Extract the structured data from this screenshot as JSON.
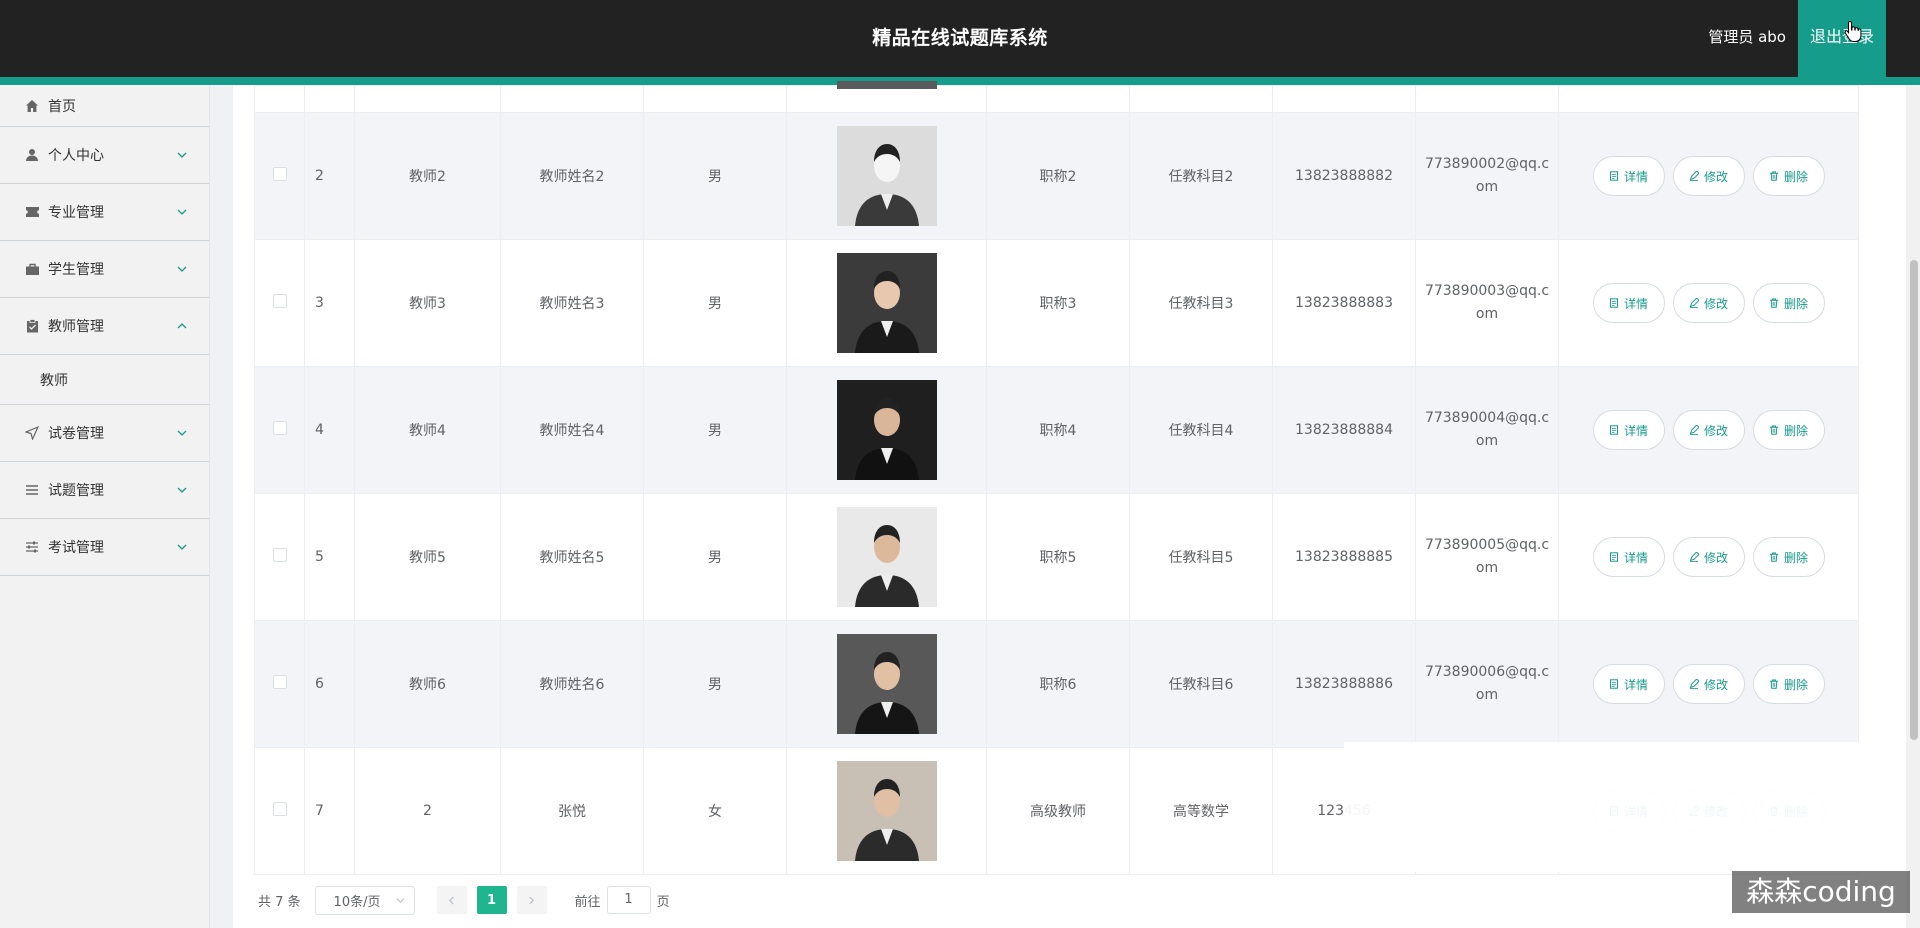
{
  "header": {
    "title": "精品在线试题库系统",
    "user": "管理员 abo",
    "logout_label": "退出登录"
  },
  "sidebar": {
    "items": [
      {
        "label": "首页",
        "icon": "home-icon"
      },
      {
        "label": "个人中心",
        "icon": "user-icon"
      },
      {
        "label": "专业管理",
        "icon": "ticket-icon"
      },
      {
        "label": "学生管理",
        "icon": "briefcase-icon"
      },
      {
        "label": "教师管理",
        "icon": "clipboard-icon",
        "expanded": true,
        "children": [
          "教师"
        ]
      },
      {
        "label": "试卷管理",
        "icon": "send-icon"
      },
      {
        "label": "试题管理",
        "icon": "list-icon"
      },
      {
        "label": "考试管理",
        "icon": "sliders-icon"
      }
    ]
  },
  "table": {
    "rows": [
      {
        "idx": "2",
        "account": "教师2",
        "name": "教师姓名2",
        "gender": "男",
        "title": "职称2",
        "subject": "任教科目2",
        "phone": "13823888882",
        "email": "773890002@qq.com"
      },
      {
        "idx": "3",
        "account": "教师3",
        "name": "教师姓名3",
        "gender": "男",
        "title": "职称3",
        "subject": "任教科目3",
        "phone": "13823888883",
        "email": "773890003@qq.com"
      },
      {
        "idx": "4",
        "account": "教师4",
        "name": "教师姓名4",
        "gender": "男",
        "title": "职称4",
        "subject": "任教科目4",
        "phone": "13823888884",
        "email": "773890004@qq.com"
      },
      {
        "idx": "5",
        "account": "教师5",
        "name": "教师姓名5",
        "gender": "男",
        "title": "职称5",
        "subject": "任教科目5",
        "phone": "13823888885",
        "email": "773890005@qq.com"
      },
      {
        "idx": "6",
        "account": "教师6",
        "name": "教师姓名6",
        "gender": "男",
        "title": "职称6",
        "subject": "任教科目6",
        "phone": "13823888886",
        "email": "773890006@qq.com"
      },
      {
        "idx": "7",
        "account": "2",
        "name": "张悦",
        "gender": "女",
        "title": "高级教师",
        "subject": "高等数学",
        "phone": "123456",
        "email": ""
      }
    ],
    "actions": {
      "detail": "详情",
      "edit": "修改",
      "delete": "删除"
    }
  },
  "pagination": {
    "total": "共 7 条",
    "page_size": "10条/页",
    "current_page": "1",
    "goto_label": "前往",
    "goto_value": "1",
    "page_suffix": "页"
  },
  "watermark": "森森coding",
  "colors": {
    "header_bg": "#222222",
    "accent": "#159c8a",
    "page_active": "#1fb58f",
    "sidebar_bg": "#f2f2f2",
    "stripe_row": "#f3f4f8"
  }
}
